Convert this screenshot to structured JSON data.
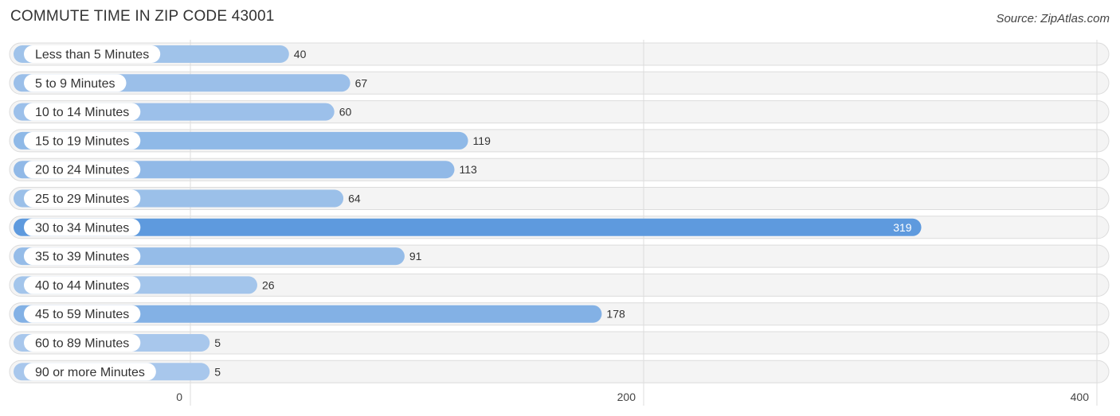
{
  "header": {
    "title": "COMMUTE TIME IN ZIP CODE 43001",
    "source": "Source: ZipAtlas.com"
  },
  "chart_data": {
    "type": "bar",
    "orientation": "horizontal",
    "title": "COMMUTE TIME IN ZIP CODE 43001",
    "xlabel": "",
    "ylabel": "",
    "categories": [
      "Less than 5 Minutes",
      "5 to 9 Minutes",
      "10 to 14 Minutes",
      "15 to 19 Minutes",
      "20 to 24 Minutes",
      "25 to 29 Minutes",
      "30 to 34 Minutes",
      "35 to 39 Minutes",
      "40 to 44 Minutes",
      "45 to 59 Minutes",
      "60 to 89 Minutes",
      "90 or more Minutes"
    ],
    "values": [
      40,
      67,
      60,
      119,
      113,
      64,
      319,
      91,
      26,
      178,
      5,
      5
    ],
    "xlim": [
      0,
      400
    ],
    "ticks": [
      0,
      200,
      400
    ],
    "tick_labels": [
      "0",
      "200",
      "400"
    ],
    "grid": true,
    "highlight_max": true,
    "colors": {
      "bar_light": "#a9c8ec",
      "bar_dark": "#5e9ade",
      "track": "#f4f4f4"
    }
  }
}
